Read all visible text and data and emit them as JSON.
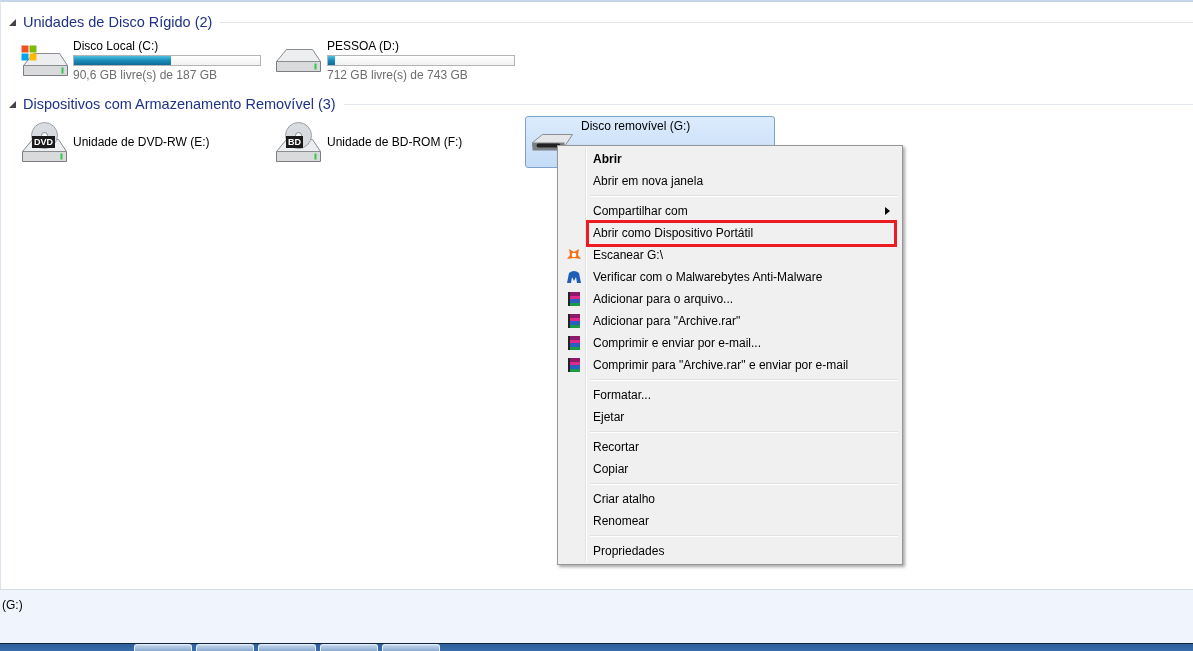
{
  "groups": [
    {
      "title": "Unidades de Disco Rígido (2)",
      "expanded": true,
      "drives": [
        {
          "kind": "system",
          "name": "Disco Local (C:)",
          "level": 0.52,
          "space": "90,6 GB livre(s) de 187 GB",
          "selected": false
        },
        {
          "kind": "disk",
          "name": "PESSOA (D:)",
          "level": 0.04,
          "space": "712 GB livre(s) de 743 GB",
          "selected": false
        }
      ]
    },
    {
      "title": "Dispositivos com Armazenamento Removível (3)",
      "expanded": true,
      "drives": [
        {
          "kind": "dvd",
          "name": "Unidade de DVD-RW (E:)",
          "badge": "DVD",
          "selected": false
        },
        {
          "kind": "bd",
          "name": "Unidade de BD-ROM (F:)",
          "badge": "BD",
          "selected": false
        },
        {
          "kind": "usb",
          "name": "Disco removível (G:)",
          "selected": true
        }
      ]
    }
  ],
  "context_menu": {
    "sections": [
      [
        {
          "kind": "plain",
          "label": "Abrir",
          "bold": true,
          "highlighted": false
        },
        {
          "kind": "plain",
          "label": "Abrir em nova janela",
          "bold": false,
          "highlighted": false
        }
      ],
      [
        {
          "kind": "submenu",
          "label": "Compartilhar com",
          "bold": false,
          "highlighted": false
        },
        {
          "kind": "plain",
          "label": "Abrir como Dispositivo Portátil",
          "bold": false,
          "highlighted": true
        },
        {
          "kind": "scan",
          "label": "Escanear G:\\",
          "bold": false,
          "highlighted": false
        },
        {
          "kind": "malware",
          "label": "Verificar com o Malwarebytes Anti-Malware",
          "bold": false,
          "highlighted": false
        },
        {
          "kind": "archive",
          "label": "Adicionar para o arquivo...",
          "bold": false,
          "highlighted": false
        },
        {
          "kind": "archive",
          "label": "Adicionar para \"Archive.rar\"",
          "bold": false,
          "highlighted": false
        },
        {
          "kind": "archive",
          "label": "Comprimir e enviar por e-mail...",
          "bold": false,
          "highlighted": false
        },
        {
          "kind": "archive",
          "label": "Comprimir para \"Archive.rar\" e enviar por e-mail",
          "bold": false,
          "highlighted": false
        }
      ],
      [
        {
          "kind": "plain",
          "label": "Formatar...",
          "bold": false,
          "highlighted": false
        },
        {
          "kind": "plain",
          "label": "Ejetar",
          "bold": false,
          "highlighted": false
        }
      ],
      [
        {
          "kind": "plain",
          "label": "Recortar",
          "bold": false,
          "highlighted": false
        },
        {
          "kind": "plain",
          "label": "Copiar",
          "bold": false,
          "highlighted": false
        }
      ],
      [
        {
          "kind": "plain",
          "label": "Criar atalho",
          "bold": false,
          "highlighted": false
        },
        {
          "kind": "plain",
          "label": "Renomear",
          "bold": false,
          "highlighted": false
        }
      ],
      [
        {
          "kind": "plain",
          "label": "Propriedades",
          "bold": false,
          "highlighted": false
        }
      ]
    ]
  },
  "status_bar": {
    "text": "(G:)"
  }
}
